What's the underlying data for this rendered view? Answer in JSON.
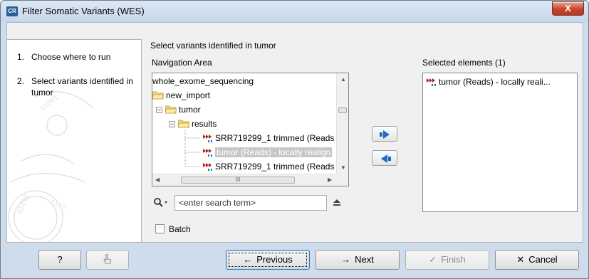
{
  "window": {
    "title": "Filter Somatic Variants (WES)",
    "app_icon": "CR",
    "close_label": "X"
  },
  "steps": [
    {
      "num": "1.",
      "label": "Choose where to run"
    },
    {
      "num": "2.",
      "label": "Select variants identified in tumor"
    }
  ],
  "main": {
    "heading": "Select variants identified in tumor",
    "nav_label": "Navigation Area",
    "tree": [
      {
        "label": "whole_exome_sequencing",
        "type": "text"
      },
      {
        "label": "new_import",
        "type": "folder"
      },
      {
        "label": "tumor",
        "type": "folder"
      },
      {
        "label": "results",
        "type": "folder"
      },
      {
        "label": "SRR719299_1 trimmed (Reads",
        "type": "reads"
      },
      {
        "label": "tumor (Reads) - locally realign",
        "type": "reads",
        "selected": true
      },
      {
        "label": "SRR719299_1 trimmed (Reads",
        "type": "reads"
      }
    ],
    "scroll_grip": "III",
    "selected_label": "Selected elements (1)",
    "selected_items": [
      "tumor (Reads) - locally reali..."
    ],
    "search_placeholder": "<enter search term>",
    "batch_label": "Batch"
  },
  "buttons": {
    "help": "?",
    "previous": "Previous",
    "next": "Next",
    "finish": "Finish",
    "cancel": "Cancel"
  },
  "colors": {
    "accent_blue": "#1a6fc4",
    "folder_yellow": "#e8c75a",
    "reads_red": "#b01d1d"
  }
}
